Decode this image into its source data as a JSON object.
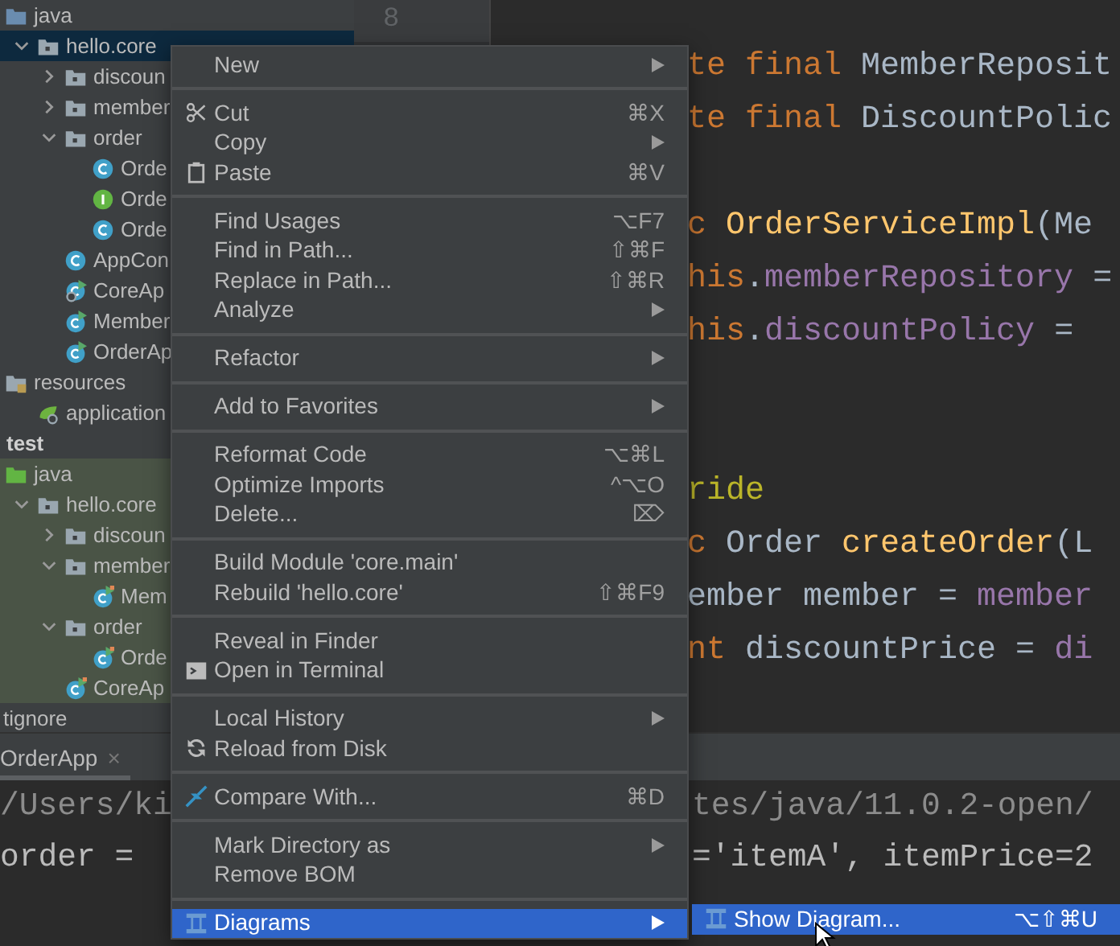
{
  "project_tree": {
    "items": [
      {
        "label": "java",
        "kind": "source-root",
        "selected": false,
        "children": [
          {
            "label": "hello.core",
            "kind": "package",
            "expanded": true,
            "selected": true,
            "children": [
              {
                "label": "discoun",
                "kind": "package",
                "expanded": false,
                "selected": false
              },
              {
                "label": "member",
                "kind": "package",
                "expanded": false,
                "selected": false
              },
              {
                "label": "order",
                "kind": "package",
                "expanded": true,
                "selected": false,
                "children": [
                  {
                    "label": "Orde",
                    "kind": "class",
                    "selected": false
                  },
                  {
                    "label": "Orde",
                    "kind": "interface",
                    "selected": false
                  },
                  {
                    "label": "Orde",
                    "kind": "class",
                    "selected": false
                  }
                ]
              },
              {
                "label": "AppCon",
                "kind": "class",
                "selected": false
              },
              {
                "label": "CoreAp",
                "kind": "config-class",
                "selected": false
              },
              {
                "label": "Member",
                "kind": "run-class",
                "selected": false
              },
              {
                "label": "OrderAp",
                "kind": "run-class",
                "selected": false
              }
            ]
          }
        ]
      },
      {
        "label": "resources",
        "kind": "resources-root",
        "selected": false,
        "children": [
          {
            "label": "application",
            "kind": "config-file",
            "selected": false
          }
        ]
      },
      {
        "label": "test",
        "kind": "group",
        "tinted": true,
        "children": [
          {
            "label": "java",
            "kind": "test-root",
            "selected": false,
            "children": [
              {
                "label": "hello.core",
                "kind": "package",
                "expanded": true,
                "selected": false,
                "children": [
                  {
                    "label": "discoun",
                    "kind": "package",
                    "expanded": false,
                    "selected": false
                  },
                  {
                    "label": "member",
                    "kind": "package",
                    "expanded": true,
                    "selected": false,
                    "children": [
                      {
                        "label": "Mem",
                        "kind": "test-class",
                        "selected": false
                      }
                    ]
                  },
                  {
                    "label": "order",
                    "kind": "package",
                    "expanded": true,
                    "selected": false,
                    "children": [
                      {
                        "label": "Orde",
                        "kind": "test-class",
                        "selected": false
                      }
                    ]
                  },
                  {
                    "label": "CoreAp",
                    "kind": "test-class",
                    "selected": false
                  }
                ]
              }
            ]
          }
        ]
      },
      {
        "label": "tignore",
        "kind": "file",
        "selected": false
      }
    ]
  },
  "editor": {
    "line_number": "8",
    "lines": [
      {
        "kind": "code",
        "segments": [
          {
            "kind": "keyword",
            "text": "te final"
          },
          {
            "kind": "plain",
            "text": " MemberReposit"
          }
        ]
      },
      {
        "kind": "code",
        "segments": [
          {
            "kind": "keyword",
            "text": "te final"
          },
          {
            "kind": "plain",
            "text": " DiscountPolic"
          }
        ]
      },
      {
        "kind": "blank"
      },
      {
        "kind": "code",
        "segments": [
          {
            "kind": "keyword",
            "text": "c "
          },
          {
            "kind": "method",
            "text": "OrderServiceImpl"
          },
          {
            "kind": "plain",
            "text": "(Me"
          }
        ]
      },
      {
        "kind": "code",
        "segments": [
          {
            "kind": "keyword",
            "text": "his"
          },
          {
            "kind": "plain",
            "text": "."
          },
          {
            "kind": "field",
            "text": "memberRepository"
          },
          {
            "kind": "plain",
            "text": " ="
          }
        ]
      },
      {
        "kind": "code",
        "segments": [
          {
            "kind": "keyword",
            "text": "his"
          },
          {
            "kind": "plain",
            "text": "."
          },
          {
            "kind": "field",
            "text": "discountPolicy"
          },
          {
            "kind": "plain",
            "text": " ="
          }
        ]
      },
      {
        "kind": "blank"
      },
      {
        "kind": "blank"
      },
      {
        "kind": "code",
        "segments": [
          {
            "kind": "annotation",
            "text": "ride"
          }
        ]
      },
      {
        "kind": "code",
        "segments": [
          {
            "kind": "keyword",
            "text": "c "
          },
          {
            "kind": "plain",
            "text": "Order "
          },
          {
            "kind": "method",
            "text": "createOrder"
          },
          {
            "kind": "plain",
            "text": "(L"
          }
        ]
      },
      {
        "kind": "code",
        "segments": [
          {
            "kind": "plain",
            "text": "ember member = "
          },
          {
            "kind": "field",
            "text": "member"
          }
        ]
      },
      {
        "kind": "code",
        "segments": [
          {
            "kind": "keyword",
            "text": "nt"
          },
          {
            "kind": "plain",
            "text": " discountPrice = "
          },
          {
            "kind": "field",
            "text": "di"
          }
        ]
      }
    ]
  },
  "run_panel": {
    "tab": {
      "label": "OrderApp",
      "close": "×",
      "selected": true
    },
    "lines": [
      {
        "left": "/Users/ki",
        "right": "tes/java/11.0.2-open/"
      },
      {
        "left": "order =",
        "right": "='itemA', itemPrice=2"
      }
    ]
  },
  "context_menu": {
    "groups": [
      {
        "items": [
          {
            "label": "New",
            "submenu": true,
            "selected": false
          }
        ]
      },
      {
        "items": [
          {
            "label": "Cut",
            "shortcut": "⌘X",
            "selected": false
          },
          {
            "label": "Copy",
            "submenu": true,
            "selected": false
          },
          {
            "label": "Paste",
            "shortcut": "⌘V",
            "selected": false
          }
        ]
      },
      {
        "items": [
          {
            "label": "Find Usages",
            "shortcut": "⌥F7",
            "selected": false
          },
          {
            "label": "Find in Path...",
            "shortcut": "⇧⌘F",
            "selected": false
          },
          {
            "label": "Replace in Path...",
            "shortcut": "⇧⌘R",
            "selected": false
          },
          {
            "label": "Analyze",
            "submenu": true,
            "selected": false
          }
        ]
      },
      {
        "items": [
          {
            "label": "Refactor",
            "submenu": true,
            "selected": false
          }
        ]
      },
      {
        "items": [
          {
            "label": "Add to Favorites",
            "submenu": true,
            "selected": false
          }
        ]
      },
      {
        "items": [
          {
            "label": "Reformat Code",
            "shortcut": "⌥⌘L",
            "selected": false
          },
          {
            "label": "Optimize Imports",
            "shortcut": "^⌥O",
            "selected": false
          },
          {
            "label": "Delete...",
            "shortcut": "⌦",
            "selected": false
          }
        ]
      },
      {
        "items": [
          {
            "label": "Build Module 'core.main'",
            "selected": false
          },
          {
            "label": "Rebuild 'hello.core'",
            "shortcut": "⇧⌘F9",
            "selected": false
          }
        ]
      },
      {
        "items": [
          {
            "label": "Reveal in Finder",
            "selected": false
          },
          {
            "label": "Open in Terminal",
            "selected": false
          }
        ]
      },
      {
        "items": [
          {
            "label": "Local History",
            "submenu": true,
            "selected": false
          },
          {
            "label": "Reload from Disk",
            "selected": false
          }
        ]
      },
      {
        "items": [
          {
            "label": "Compare With...",
            "shortcut": "⌘D",
            "selected": false
          }
        ]
      },
      {
        "items": [
          {
            "label": "Mark Directory as",
            "submenu": true,
            "selected": false
          },
          {
            "label": "Remove BOM",
            "selected": false
          }
        ]
      },
      {
        "items": [
          {
            "label": "Diagrams",
            "submenu": true,
            "selected": true
          }
        ]
      }
    ]
  },
  "submenu": {
    "items": [
      {
        "label": "Show Diagram...",
        "shortcut": "⌥⇧⌘U",
        "selected": true
      }
    ]
  }
}
